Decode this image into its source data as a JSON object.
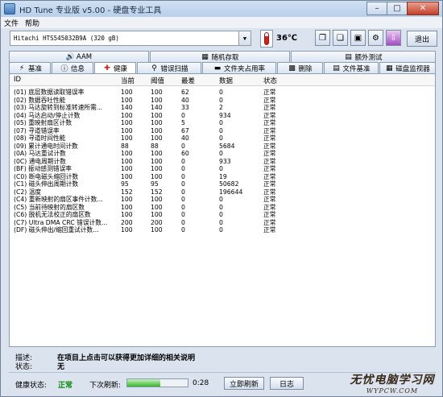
{
  "window": {
    "title": "HD Tune 专业版 v5.00 - 硬盘专业工具"
  },
  "menu": {
    "items": [
      "文件",
      "帮助"
    ]
  },
  "toolbar": {
    "drive": "Hitachi HTS545032B9A    (320 gB)",
    "temperature": "36℃",
    "exit_label": "退出"
  },
  "tabs_top": [
    "AAM",
    "随机存取",
    "额外测试"
  ],
  "tabs_bottom": [
    "基准",
    "信息",
    "健康",
    "错误扫描",
    "文件夹占用率",
    "删除",
    "文件基准",
    "磁盘监视器"
  ],
  "table": {
    "headers": [
      "ID",
      "当前",
      "阈值",
      "最差",
      "数据",
      "状态"
    ],
    "rows": [
      [
        "(01) 底层数据读取错误率",
        "100",
        "100",
        "62",
        "0",
        "正常"
      ],
      [
        "(02) 数据吞吐性能",
        "100",
        "100",
        "40",
        "0",
        "正常"
      ],
      [
        "(03) 马达旋转到标准转速所需...",
        "140",
        "140",
        "33",
        "2",
        "正常"
      ],
      [
        "(04) 马达启动/停止计数",
        "100",
        "100",
        "0",
        "934",
        "正常"
      ],
      [
        "(05) 重映射扇区计数",
        "100",
        "100",
        "5",
        "0",
        "正常"
      ],
      [
        "(07) 寻道错误率",
        "100",
        "100",
        "67",
        "0",
        "正常"
      ],
      [
        "(08) 寻道时间性能",
        "100",
        "100",
        "40",
        "0",
        "正常"
      ],
      [
        "(09) 累计通电时间计数",
        "88",
        "88",
        "0",
        "5684",
        "正常"
      ],
      [
        "(0A) 马达重试计数",
        "100",
        "100",
        "60",
        "0",
        "正常"
      ],
      [
        "(0C) 通电周期计数",
        "100",
        "100",
        "0",
        "933",
        "正常"
      ],
      [
        "(BF) 振动感测错误率",
        "100",
        "100",
        "0",
        "0",
        "正常"
      ],
      [
        "(C0) 断电磁头缩回计数",
        "100",
        "100",
        "0",
        "19",
        "正常"
      ],
      [
        "(C1) 磁头伸出周期计数",
        "95",
        "95",
        "0",
        "50682",
        "正常"
      ],
      [
        "(C2) 温度",
        "152",
        "152",
        "0",
        "196644",
        "正常"
      ],
      [
        "(C4) 重新映射的扇区事件计数...",
        "100",
        "100",
        "0",
        "0",
        "正常"
      ],
      [
        "(C5) 当前待映射的扇区数",
        "100",
        "100",
        "0",
        "0",
        "正常"
      ],
      [
        "(C6) 脱机无法校正的扇区数",
        "100",
        "100",
        "0",
        "0",
        "正常"
      ],
      [
        "(C7) Ultra DMA CRC 错误计数...",
        "200",
        "200",
        "0",
        "0",
        "正常"
      ],
      [
        "(DF) 磁头伸出/缩回重试计数...",
        "100",
        "100",
        "0",
        "0",
        "正常"
      ]
    ]
  },
  "description": {
    "label": "描述:",
    "value": "在项目上点击可以获得更加详细的相关说明"
  },
  "status": {
    "label": "状态:",
    "value": "无"
  },
  "footer": {
    "health_label": "健康状态:",
    "health_value": "正常",
    "refresh_label": "下次刷新:",
    "progress_fraction": 0.55,
    "timer": "0:28",
    "refresh_button": "立即刷新",
    "log_button": "日志"
  },
  "watermark": {
    "main": "无忧电脑学习网",
    "sub": "WYPCW.COM"
  },
  "colors": {
    "health_ok": "#0a8a0a",
    "temperature": "#d0221a"
  }
}
